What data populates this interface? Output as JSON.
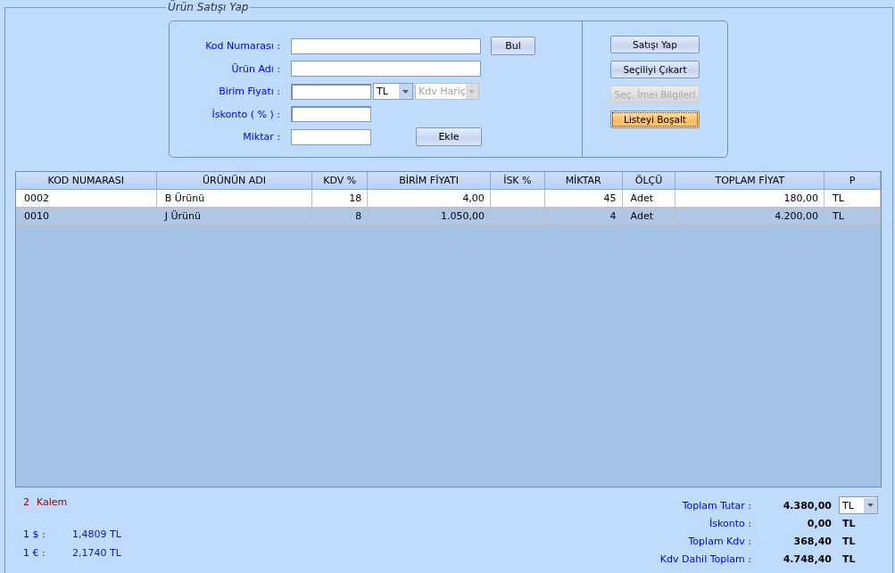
{
  "group_title": "Ürün Satışı Yap",
  "form": {
    "fields": [
      {
        "label": "Kod Numarası  :",
        "kind": "wide"
      },
      {
        "label": "Ürün Adı  :",
        "kind": "wide"
      },
      {
        "label": "Birim Fiyatı  :",
        "kind": "price",
        "currency": "TL",
        "vat_mode": "Kdv Hariç"
      },
      {
        "label": "İskonto ( % )  :",
        "kind": "short"
      },
      {
        "label": "Miktar  :",
        "kind": "short"
      }
    ],
    "find_button": "Bul",
    "add_button": "Ekle"
  },
  "actions": [
    {
      "label": "Satışı Yap",
      "disabled": false,
      "focused": false
    },
    {
      "label": "Seçiliyi Çıkart",
      "disabled": false,
      "focused": false
    },
    {
      "label": "Seç. İmei Bilgileri",
      "disabled": true,
      "focused": false
    },
    {
      "label": "Listeyi Boşalt",
      "disabled": false,
      "focused": true
    }
  ],
  "table": {
    "columns": [
      {
        "label": "KOD NUMARASI"
      },
      {
        "label": "ÜRÜNÜN ADI"
      },
      {
        "label": "KDV %"
      },
      {
        "label": "BİRİM FİYATI"
      },
      {
        "label": "İSK %"
      },
      {
        "label": "MİKTAR"
      },
      {
        "label": "ÖLÇÜ"
      },
      {
        "label": "TOPLAM FİYAT"
      },
      {
        "label": "P"
      }
    ],
    "rows": [
      {
        "selected": false,
        "cells": [
          "0002",
          "B Ürünü",
          "18",
          "4,00",
          "",
          "45",
          "Adet",
          "180,00",
          "TL"
        ]
      },
      {
        "selected": true,
        "cells": [
          "0010",
          "J Ürünü",
          "8",
          "1.050,00",
          "",
          "4",
          "Adet",
          "4.200,00",
          "TL"
        ]
      }
    ]
  },
  "item_count": {
    "number": "2",
    "label": "Kalem"
  },
  "rates": [
    {
      "label": "1 $ :",
      "value": "1,4809 TL"
    },
    {
      "label": "1 € :",
      "value": "2,1740 TL"
    }
  ],
  "totals": [
    {
      "label": "Toplam Tutar :",
      "value": "4.380,00",
      "currency": "TL",
      "kind": "dropdown"
    },
    {
      "label": "İskonto :",
      "value": "0,00",
      "currency": "TL",
      "kind": "text"
    },
    {
      "label": "Toplam Kdv :",
      "value": "368,40",
      "currency": "TL",
      "kind": "text"
    },
    {
      "label": "Kdv Dahil Toplam :",
      "value": "4.748,40",
      "currency": "TL",
      "kind": "text"
    }
  ]
}
